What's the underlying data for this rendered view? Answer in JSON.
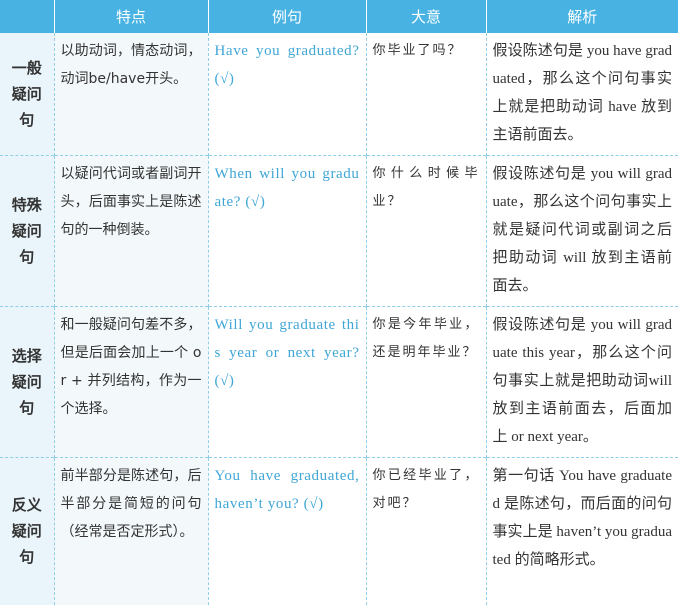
{
  "headers": [
    "",
    "特点",
    "例句",
    "大意",
    "解析"
  ],
  "rows": [
    {
      "type": "一般疑问句",
      "feature": "以助动词，情态动词，动词be/have开头。",
      "example": "Have you graduated? (√)",
      "meaning": "你毕业了吗？",
      "analysis": "假设陈述句是 you have graduated，那么这个问句事实上就是把助动词 have 放到主语前面去。"
    },
    {
      "type": "特殊疑问句",
      "feature": "以疑问代词或者副词开头，后面事实上是陈述句的一种倒装。",
      "example": "When will you graduate? (√)",
      "meaning": "你什么时候毕业？",
      "analysis": "假设陈述句是 you will graduate，那么这个问句事实上就是疑问代词或副词之后把助动词 will 放到主语前面去。"
    },
    {
      "type": "选择疑问句",
      "feature": "和一般疑问句差不多，但是后面会加上一个 or + 并列结构，作为一个选择。",
      "example": "Will you graduate this year or next year? (√)",
      "meaning": "你是今年毕业，还是明年毕业？",
      "analysis": "假设陈述句是 you will graduate this year，那么这个问句事实上就是把助动词will放到主语前面去，后面加上 or next year。"
    },
    {
      "type": "反义疑问句",
      "feature": "前半部分是陈述句，后半部分是简短的问句（经常是否定形式）。",
      "example": "You have graduated, haven’t you? (√)",
      "meaning": "你已经毕业了，对吧？",
      "analysis": "第一句话 You have graduated 是陈述句，而后面的问句事实上是 haven’t you graduated 的简略形式。"
    }
  ]
}
